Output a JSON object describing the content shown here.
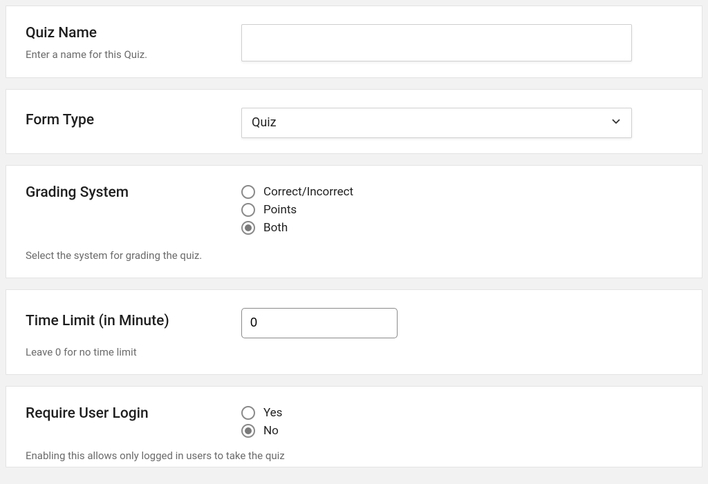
{
  "quizName": {
    "label": "Quiz Name",
    "help": "Enter a name for this Quiz.",
    "value": ""
  },
  "formType": {
    "label": "Form Type",
    "selected": "Quiz"
  },
  "gradingSystem": {
    "label": "Grading System",
    "help": "Select the system for grading the quiz.",
    "options": {
      "correct": "Correct/Incorrect",
      "points": "Points",
      "both": "Both"
    },
    "selected": "both"
  },
  "timeLimit": {
    "label": "Time Limit (in Minute)",
    "help": "Leave 0 for no time limit",
    "value": "0"
  },
  "requireLogin": {
    "label": "Require User Login",
    "help": "Enabling this allows only logged in users to take the quiz",
    "options": {
      "yes": "Yes",
      "no": "No"
    },
    "selected": "no"
  }
}
